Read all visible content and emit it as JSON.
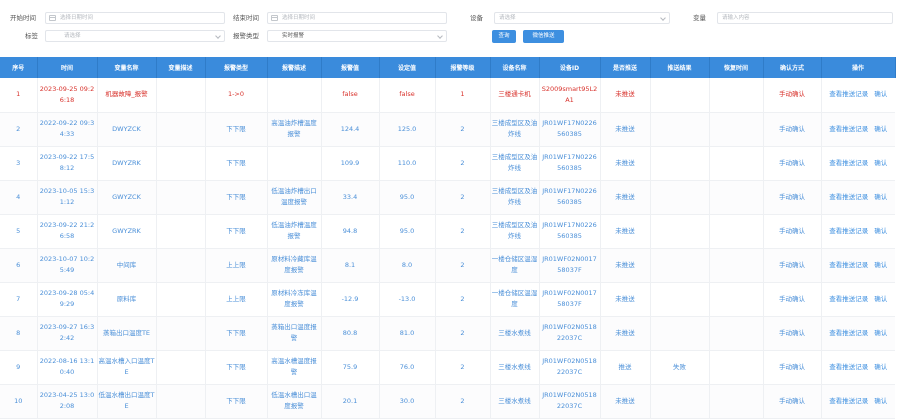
{
  "filters": {
    "start_time_label": "开始时间",
    "start_time_placeholder": "选择日期时间",
    "end_time_label": "结束时间",
    "end_time_placeholder": "选择日期时间",
    "device_label": "设备",
    "device_placeholder": "请选择",
    "variable_label": "变量",
    "variable_placeholder": "请输入内容",
    "tag_label": "标签",
    "tag_placeholder": "请选择",
    "alarm_type_label": "报警类型",
    "alarm_type_value": "实时报警",
    "query_button": "查询",
    "wechat_push_button": "微信推送"
  },
  "table": {
    "headers": [
      "序号",
      "时间",
      "变量名称",
      "变量描述",
      "报警类型",
      "报警描述",
      "报警值",
      "设定值",
      "报警等级",
      "设备名称",
      "设备ID",
      "是否推送",
      "推送结果",
      "恢复时间",
      "确认方式",
      "操作"
    ],
    "rows": [
      {
        "no": "1",
        "time": "2023-09-25 09:26:18",
        "var_name": "机器故障_报警",
        "var_desc": "",
        "alarm_type": "1->0",
        "alarm_desc": "",
        "alarm_value": "false",
        "set_value": "false",
        "level": "1",
        "device_name": "三楼通卡机",
        "device_id": "S2009smart95L2A1",
        "pushed": "未推送",
        "push_result": "",
        "recover_time": "",
        "confirm_mode": "手动确认",
        "op_view": "查看推送记录",
        "op_confirm": "确认"
      },
      {
        "no": "2",
        "time": "2022-09-22 09:34:33",
        "var_name": "DWYZCK",
        "var_desc": "",
        "alarm_type": "下下限",
        "alarm_desc": "高温油炸槽温度报警",
        "alarm_value": "124.4",
        "set_value": "125.0",
        "level": "2",
        "device_name": "三楼成型区及油炸线",
        "device_id": "JR01WF17N0226560385",
        "pushed": "未推送",
        "push_result": "",
        "recover_time": "",
        "confirm_mode": "手动确认",
        "op_view": "查看推送记录",
        "op_confirm": "确认"
      },
      {
        "no": "3",
        "time": "2023-09-22 17:58:12",
        "var_name": "DWYZRK",
        "var_desc": "",
        "alarm_type": "下下限",
        "alarm_desc": "",
        "alarm_value": "109.9",
        "set_value": "110.0",
        "level": "2",
        "device_name": "三楼成型区及油炸线",
        "device_id": "JR01WF17N0226560385",
        "pushed": "未推送",
        "push_result": "",
        "recover_time": "",
        "confirm_mode": "手动确认",
        "op_view": "查看推送记录",
        "op_confirm": "确认"
      },
      {
        "no": "4",
        "time": "2023-10-05 15:31:12",
        "var_name": "GWYZCK",
        "var_desc": "",
        "alarm_type": "下下限",
        "alarm_desc": "低温油炸槽出口温度报警",
        "alarm_value": "33.4",
        "set_value": "95.0",
        "level": "2",
        "device_name": "三楼成型区及油炸线",
        "device_id": "JR01WF17N0226560385",
        "pushed": "未推送",
        "push_result": "",
        "recover_time": "",
        "confirm_mode": "手动确认",
        "op_view": "查看推送记录",
        "op_confirm": "确认"
      },
      {
        "no": "5",
        "time": "2023-09-22 21:26:58",
        "var_name": "GWYZRK",
        "var_desc": "",
        "alarm_type": "下下限",
        "alarm_desc": "低温油炸槽温度报警",
        "alarm_value": "94.8",
        "set_value": "95.0",
        "level": "2",
        "device_name": "三楼成型区及油炸线",
        "device_id": "JR01WF17N0226560385",
        "pushed": "未推送",
        "push_result": "",
        "recover_time": "",
        "confirm_mode": "手动确认",
        "op_view": "查看推送记录",
        "op_confirm": "确认"
      },
      {
        "no": "6",
        "time": "2023-10-07 10:25:49",
        "var_name": "中间库",
        "var_desc": "",
        "alarm_type": "上上限",
        "alarm_desc": "原材料冷藏库温度报警",
        "alarm_value": "8.1",
        "set_value": "8.0",
        "level": "2",
        "device_name": "一楼仓储区温湿度",
        "device_id": "JR01WF02N001758037F",
        "pushed": "未推送",
        "push_result": "",
        "recover_time": "",
        "confirm_mode": "手动确认",
        "op_view": "查看推送记录",
        "op_confirm": "确认"
      },
      {
        "no": "7",
        "time": "2023-09-28 05:49:29",
        "var_name": "原料库",
        "var_desc": "",
        "alarm_type": "上上限",
        "alarm_desc": "原材料冷冻库温度报警",
        "alarm_value": "-12.9",
        "set_value": "-13.0",
        "level": "2",
        "device_name": "一楼仓储区温湿度",
        "device_id": "JR01WF02N001758037F",
        "pushed": "未推送",
        "push_result": "",
        "recover_time": "",
        "confirm_mode": "手动确认",
        "op_view": "查看推送记录",
        "op_confirm": "确认"
      },
      {
        "no": "8",
        "time": "2023-09-27 16:32:42",
        "var_name": "蒸箱出口温度TE",
        "var_desc": "",
        "alarm_type": "下下限",
        "alarm_desc": "蒸箱出口温度报警",
        "alarm_value": "80.8",
        "set_value": "81.0",
        "level": "2",
        "device_name": "三楼水煮线",
        "device_id": "JR01WF02N051822037C",
        "pushed": "未推送",
        "push_result": "",
        "recover_time": "",
        "confirm_mode": "手动确认",
        "op_view": "查看推送记录",
        "op_confirm": "确认"
      },
      {
        "no": "9",
        "time": "2022-08-16 13:10:40",
        "var_name": "高温水槽入口温度TE",
        "var_desc": "",
        "alarm_type": "下下限",
        "alarm_desc": "高温水槽温度报警",
        "alarm_value": "75.9",
        "set_value": "76.0",
        "level": "2",
        "device_name": "三楼水煮线",
        "device_id": "JR01WF02N051822037C",
        "pushed": "推送",
        "push_result": "失败",
        "recover_time": "",
        "confirm_mode": "手动确认",
        "op_view": "查看推送记录",
        "op_confirm": "确认"
      },
      {
        "no": "10",
        "time": "2023-04-25 13:02:08",
        "var_name": "低温水槽出口温度TE",
        "var_desc": "",
        "alarm_type": "下下限",
        "alarm_desc": "低温水槽出口温度报警",
        "alarm_value": "20.1",
        "set_value": "30.0",
        "level": "2",
        "device_name": "三楼水煮线",
        "device_id": "JR01WF02N051822037C",
        "pushed": "未推送",
        "push_result": "",
        "recover_time": "",
        "confirm_mode": "手动确认",
        "op_view": "查看推送记录",
        "op_confirm": "确认"
      }
    ]
  }
}
